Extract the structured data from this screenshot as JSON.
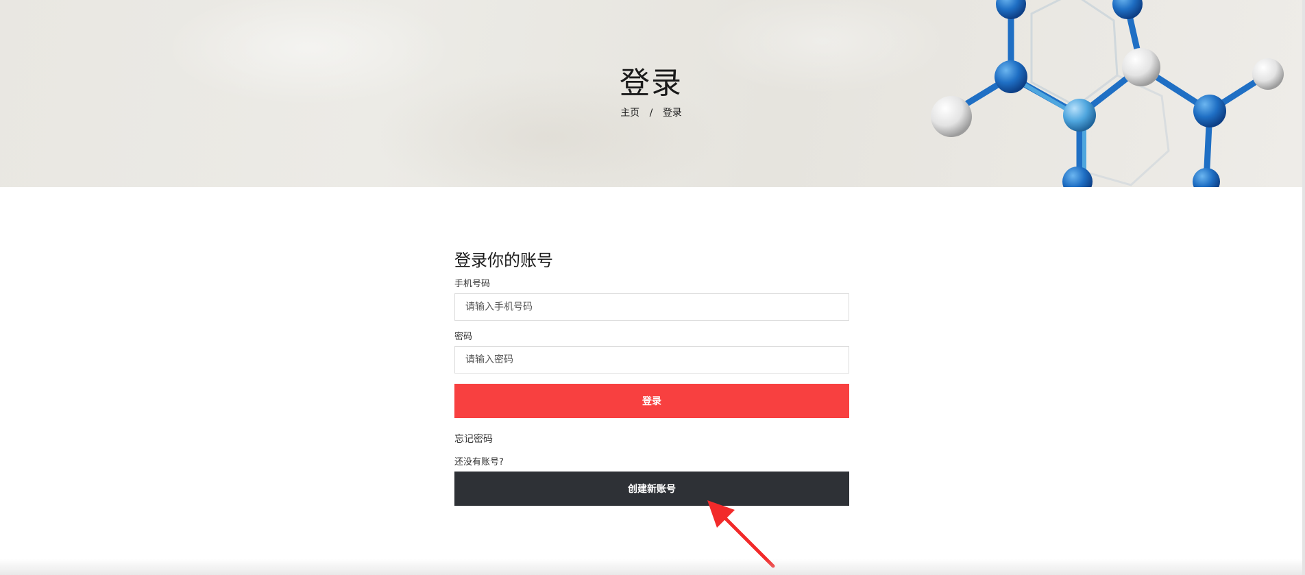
{
  "hero": {
    "title": "登录",
    "breadcrumb": {
      "home": "主页",
      "separator": "/",
      "current": "登录"
    }
  },
  "form": {
    "heading": "登录你的账号",
    "phone": {
      "label": "手机号码",
      "placeholder": "请输入手机号码",
      "value": ""
    },
    "password": {
      "label": "密码",
      "placeholder": "请输入密码",
      "value": ""
    },
    "login_label": "登录",
    "forgot_label": "忘记密码",
    "no_account_text": "还没有账号?",
    "create_label": "创建新账号"
  },
  "colors": {
    "login_button": "#f84040",
    "create_button": "#2e3136",
    "annotation_arrow": "#f22a2a",
    "molecule_blue": "#1f6fc4",
    "molecule_light_blue": "#4fa6de"
  },
  "icons": {
    "annotation": "arrow-pointer-icon",
    "hero_image": "molecule-illustration"
  }
}
